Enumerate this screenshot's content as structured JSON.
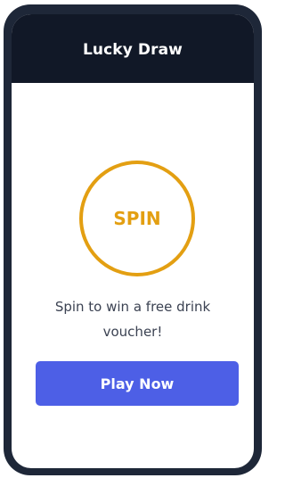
{
  "header": {
    "title": "Lucky Draw"
  },
  "wheel": {
    "label": "SPIN",
    "accent_color": "#e39f12"
  },
  "message": {
    "text": "Spin to win a free drink voucher!"
  },
  "cta": {
    "label": "Play Now",
    "color": "#4d5fe6"
  },
  "theme": {
    "frame_color": "#1e2738",
    "header_color": "#111827"
  }
}
